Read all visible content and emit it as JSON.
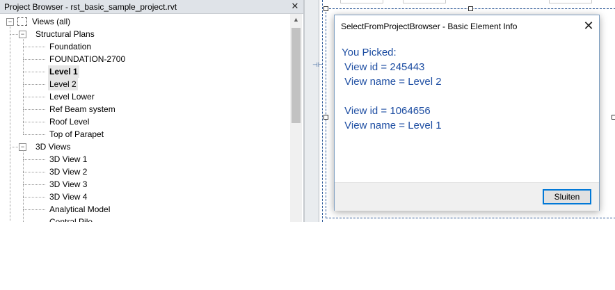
{
  "project_browser": {
    "title": "Project Browser - rst_basic_sample_project.rvt",
    "close_glyph": "✕",
    "root": {
      "label": "Views (all)",
      "expander": "−",
      "icon": "views-icon"
    },
    "groups": [
      {
        "label": "Structural Plans",
        "expander": "−",
        "items": [
          {
            "label": "Foundation"
          },
          {
            "label": "FOUNDATION-2700"
          },
          {
            "label": "Level 1",
            "bold": true,
            "selected": true
          },
          {
            "label": "Level 2",
            "selected": true
          },
          {
            "label": "Level Lower"
          },
          {
            "label": "Ref Beam system"
          },
          {
            "label": "Roof Level"
          },
          {
            "label": "Top of Parapet"
          }
        ]
      },
      {
        "label": "3D Views",
        "expander": "−",
        "items": [
          {
            "label": "3D View 1"
          },
          {
            "label": "3D View 2"
          },
          {
            "label": "3D View 3"
          },
          {
            "label": "3D View 4"
          },
          {
            "label": "Analytical Model"
          },
          {
            "label": "Central Pile"
          }
        ]
      }
    ],
    "scroll_up_glyph": "▲"
  },
  "dialog": {
    "title": "SelectFromProjectBrowser - Basic Element Info",
    "close_glyph": "✕",
    "lines": [
      "You Picked:",
      " View id = 245443",
      " View name = Level 2",
      "",
      " View id = 1064656",
      " View name = Level 1"
    ],
    "button_label": "Sluiten",
    "text_color": "#1f4fa3"
  },
  "colors": {
    "selection": "#e6e6e6",
    "crop_region": "#2b5797",
    "focus_border": "#0078d7"
  }
}
